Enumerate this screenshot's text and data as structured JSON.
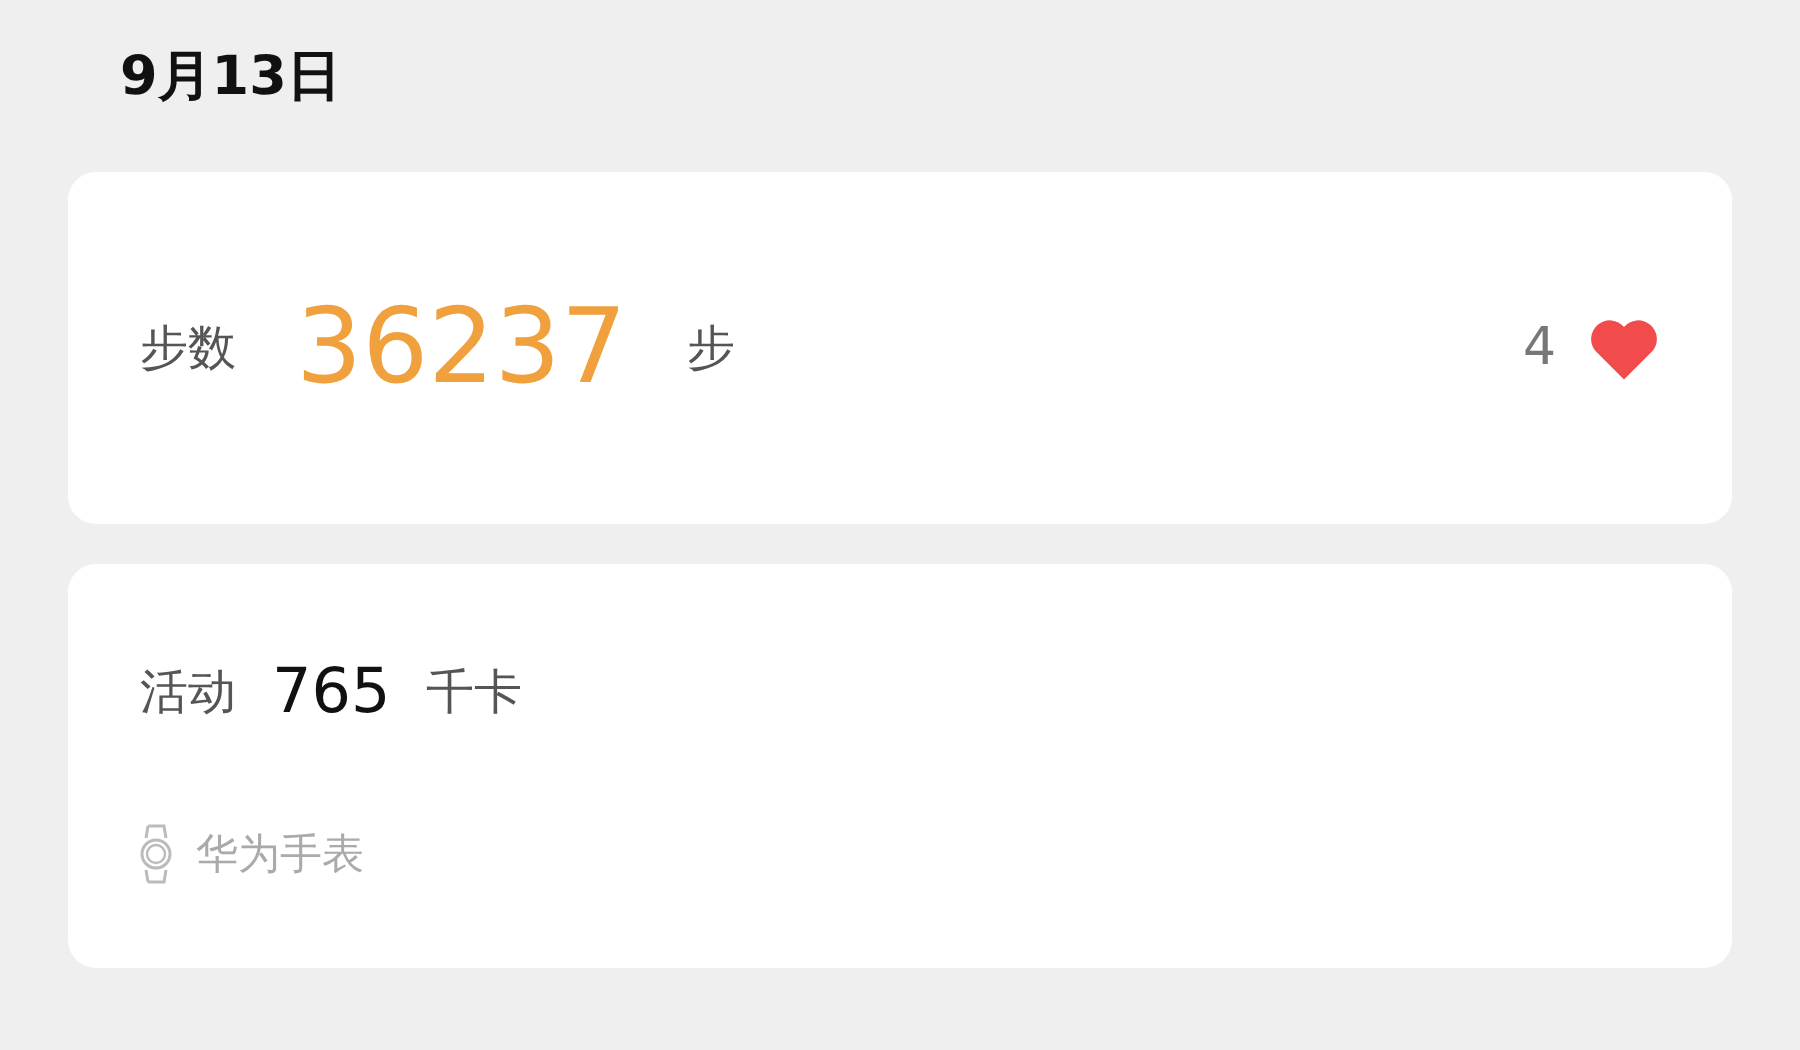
{
  "date": "9月13日",
  "steps": {
    "label": "步数",
    "value": "36237",
    "unit": "步",
    "likes": "4"
  },
  "activity": {
    "label": "活动",
    "value": "765",
    "unit": "千卡",
    "source": "华为手表"
  }
}
